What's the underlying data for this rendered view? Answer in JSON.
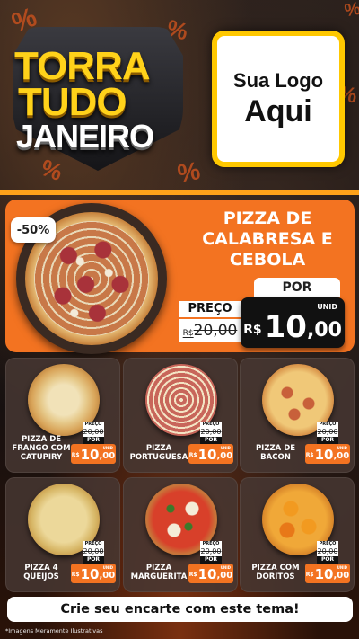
{
  "header": {
    "title_line1": "TORRA",
    "title_line2": "TUDO",
    "title_line3": "JANEIRO",
    "logo_line1": "Sua Logo",
    "logo_line2": "Aqui",
    "decor_symbol": "%"
  },
  "featured": {
    "discount_badge": "-50%",
    "name": "PIZZA DE CALABRESA E CEBOLA",
    "por_label": "POR",
    "preco_label": "PREÇO",
    "old_currency": "R$",
    "old_price": "20,00",
    "new_currency": "R$",
    "new_price_int": "10",
    "new_price_dec": ",00",
    "unit": "UNID"
  },
  "price_labels": {
    "preco": "PREÇO",
    "old_price": "20,00",
    "por": "POR",
    "currency": "R$",
    "int": "10",
    "dec": ",00",
    "unit": "UNID"
  },
  "products": [
    {
      "name": "PIZZA DE FRANGO COM CATUPIRY"
    },
    {
      "name": "PIZZA PORTUGUESA"
    },
    {
      "name": "PIZZA DE BACON"
    },
    {
      "name": "PIZZA 4 QUEIJOS"
    },
    {
      "name": "PIZZA MARGUERITA"
    },
    {
      "name": "PIZZA COM DORITOS"
    }
  ],
  "cta": "Crie seu encarte com este tema!",
  "footer_note": "*Imagens Meramente Ilustrativas",
  "colors": {
    "accent_orange": "#f37321",
    "title_yellow": "#ffd21a",
    "logo_border": "#ffc800"
  }
}
